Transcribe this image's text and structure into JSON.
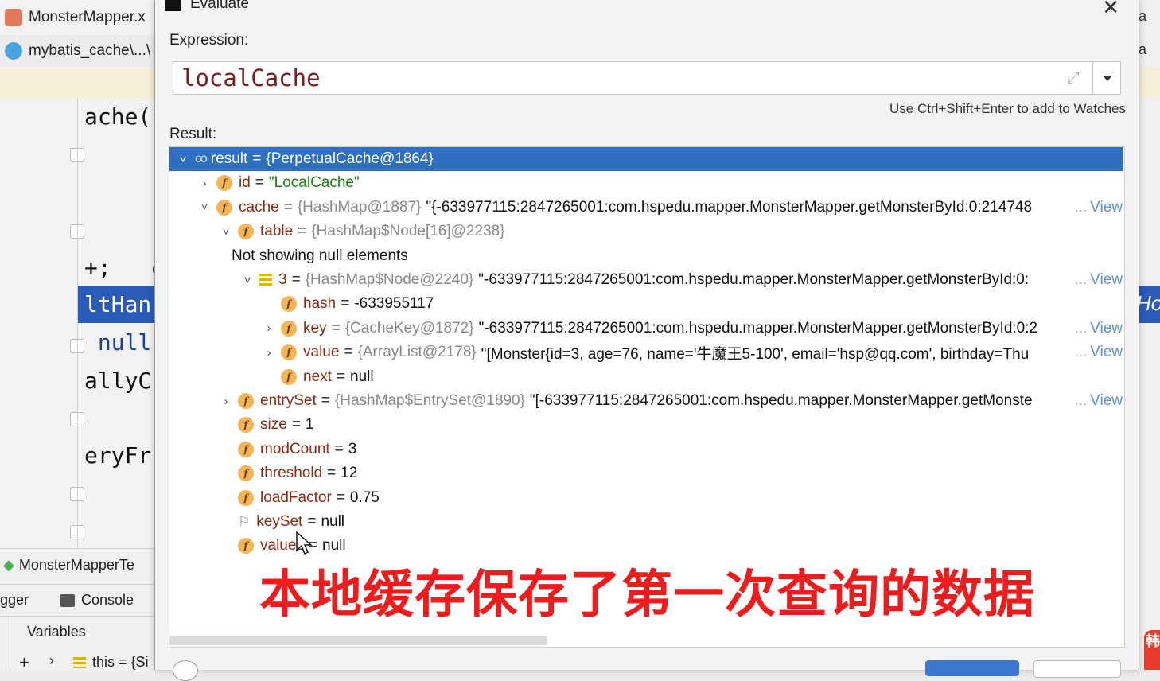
{
  "ide": {
    "tabs": [
      {
        "label": "MonsterMapper.x"
      },
      {
        "label": "mybatis_cache\\...\\"
      }
    ],
    "code_lines": [
      "ache(",
      "+;   q",
      "ltHan",
      " null",
      "allyC",
      "eryFr"
    ],
    "bottom_tool_tab": "MonsterMapperTe",
    "debugger_tab": "gger",
    "console_tab": "Console",
    "variables_label": "Variables",
    "this_var": "this = {Si",
    "right_strip_glyphs": [
      "a",
      "a"
    ],
    "right_highlight_text": "Ho",
    "badge_text": "韩"
  },
  "dialog": {
    "title": "Evaluate",
    "expression_label": "Expression:",
    "expression_value": "localCache",
    "watch_hint": "Use Ctrl+Shift+Enter to add to Watches",
    "result_label": "Result:"
  },
  "tree": [
    {
      "arrow": "˅",
      "icon": "watch-glasses-icon",
      "name": "result",
      "type": "{PerpetualCache@1864}",
      "value": "",
      "view": ""
    },
    {
      "arrow": "›",
      "icon": "field-icon",
      "name": "id",
      "type": "",
      "value": "\"LocalCache\"",
      "view": ""
    },
    {
      "arrow": "˅",
      "icon": "field-icon",
      "name": "cache",
      "type": "{HashMap@1887}",
      "value": "\"{-633977115:2847265001:com.hspedu.mapper.MonsterMapper.getMonsterById:0:214748",
      "view": "View"
    },
    {
      "arrow": "˅",
      "icon": "field-icon",
      "name": "table",
      "type": "{HashMap$Node[16]@2238}",
      "value": "",
      "view": ""
    },
    {
      "arrow": "",
      "icon": "",
      "name": "",
      "type": "",
      "value": "Not showing null elements",
      "view": ""
    },
    {
      "arrow": "˅",
      "icon": "array-element-icon",
      "name": "3",
      "type": "{HashMap$Node@2240}",
      "value": "\"-633977115:2847265001:com.hspedu.mapper.MonsterMapper.getMonsterById:0:",
      "view": "View"
    },
    {
      "arrow": "",
      "icon": "field-icon",
      "name": "hash",
      "type": "",
      "value": "-633955117",
      "view": ""
    },
    {
      "arrow": "›",
      "icon": "field-icon",
      "name": "key",
      "type": "{CacheKey@1872}",
      "value": "\"-633977115:2847265001:com.hspedu.mapper.MonsterMapper.getMonsterById:0:2",
      "view": "View"
    },
    {
      "arrow": "›",
      "icon": "field-icon",
      "name": "value",
      "type": "{ArrayList@2178}",
      "value": "\"[Monster{id=3, age=76, name='牛魔王5-100', email='hsp@qq.com', birthday=Thu",
      "view": "View"
    },
    {
      "arrow": "",
      "icon": "field-icon",
      "name": "next",
      "type": "",
      "value": "null",
      "view": ""
    },
    {
      "arrow": "›",
      "icon": "field-icon",
      "name": "entrySet",
      "type": "{HashMap$EntrySet@1890}",
      "value": "\"[-633977115:2847265001:com.hspedu.mapper.MonsterMapper.getMonste",
      "view": "View"
    },
    {
      "arrow": "",
      "icon": "field-icon",
      "name": "size",
      "type": "",
      "value": "1",
      "view": ""
    },
    {
      "arrow": "",
      "icon": "field-icon",
      "name": "modCount",
      "type": "",
      "value": "3",
      "view": ""
    },
    {
      "arrow": "",
      "icon": "field-icon",
      "name": "threshold",
      "type": "",
      "value": "12",
      "view": ""
    },
    {
      "arrow": "",
      "icon": "field-icon",
      "name": "loadFactor",
      "type": "",
      "value": "0.75",
      "view": ""
    },
    {
      "arrow": "",
      "icon": "flag-icon",
      "name": "keySet",
      "type": "",
      "value": "null",
      "view": ""
    },
    {
      "arrow": "",
      "icon": "field-icon",
      "name": "values",
      "type": "",
      "value": "null",
      "view": ""
    }
  ],
  "caption": "本地缓存保存了第一次查询的数据",
  "colors": {
    "selection": "#2e6fc1",
    "caption": "#ee1c1c",
    "field_name": "#8a2c12",
    "string": "#17800e",
    "view_link": "#5c8ed1"
  }
}
